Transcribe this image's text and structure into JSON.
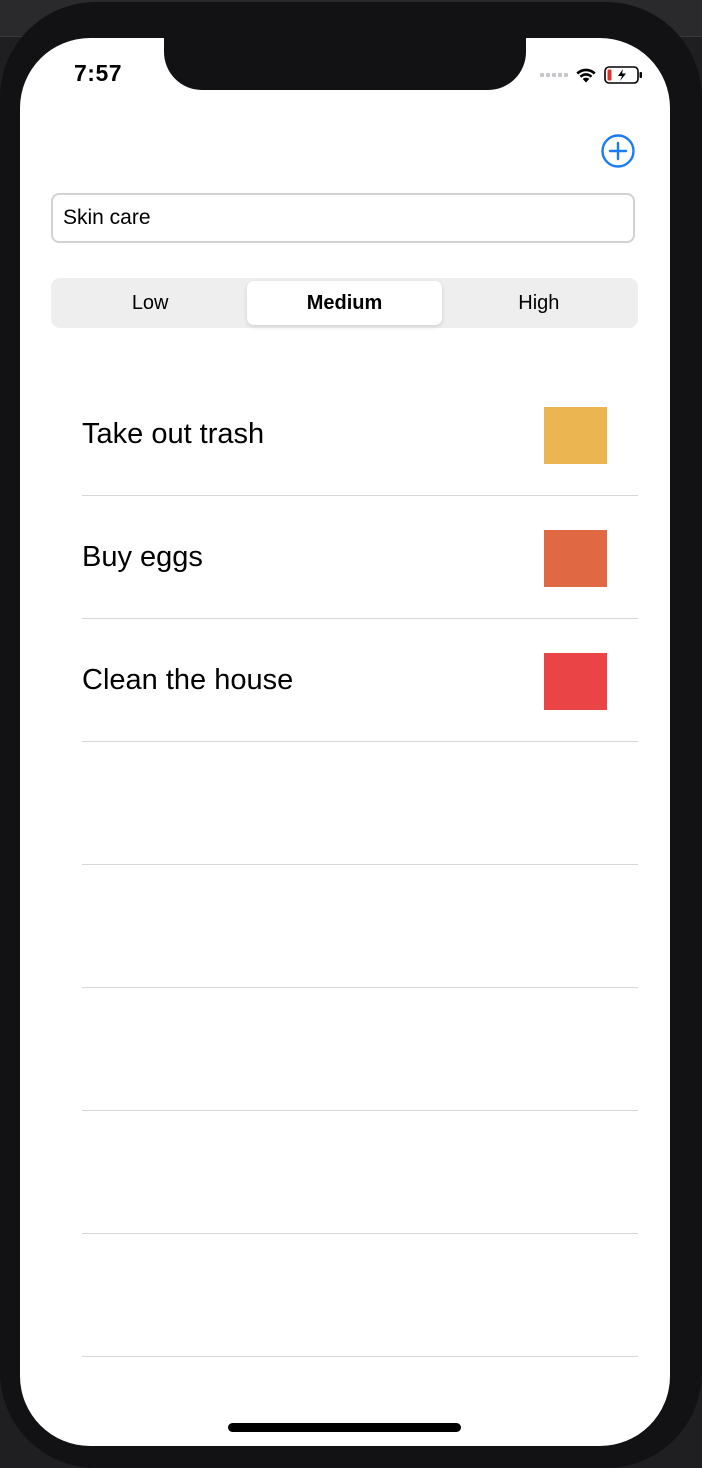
{
  "status_bar": {
    "time": "7:57"
  },
  "header": {
    "add_button_icon": "plus-circle-icon",
    "accent_color": "#1a7cf5"
  },
  "input": {
    "value": "Skin care"
  },
  "priority": {
    "options": [
      "Low",
      "Medium",
      "High"
    ],
    "selected": "Medium"
  },
  "items": [
    {
      "title": "Take out trash",
      "color": "#ebb552"
    },
    {
      "title": "Buy eggs",
      "color": "#e06842"
    },
    {
      "title": "Clean the house",
      "color": "#eb4446"
    },
    {
      "title": "",
      "color": ""
    },
    {
      "title": "",
      "color": ""
    },
    {
      "title": "",
      "color": ""
    },
    {
      "title": "",
      "color": ""
    },
    {
      "title": "",
      "color": ""
    }
  ]
}
